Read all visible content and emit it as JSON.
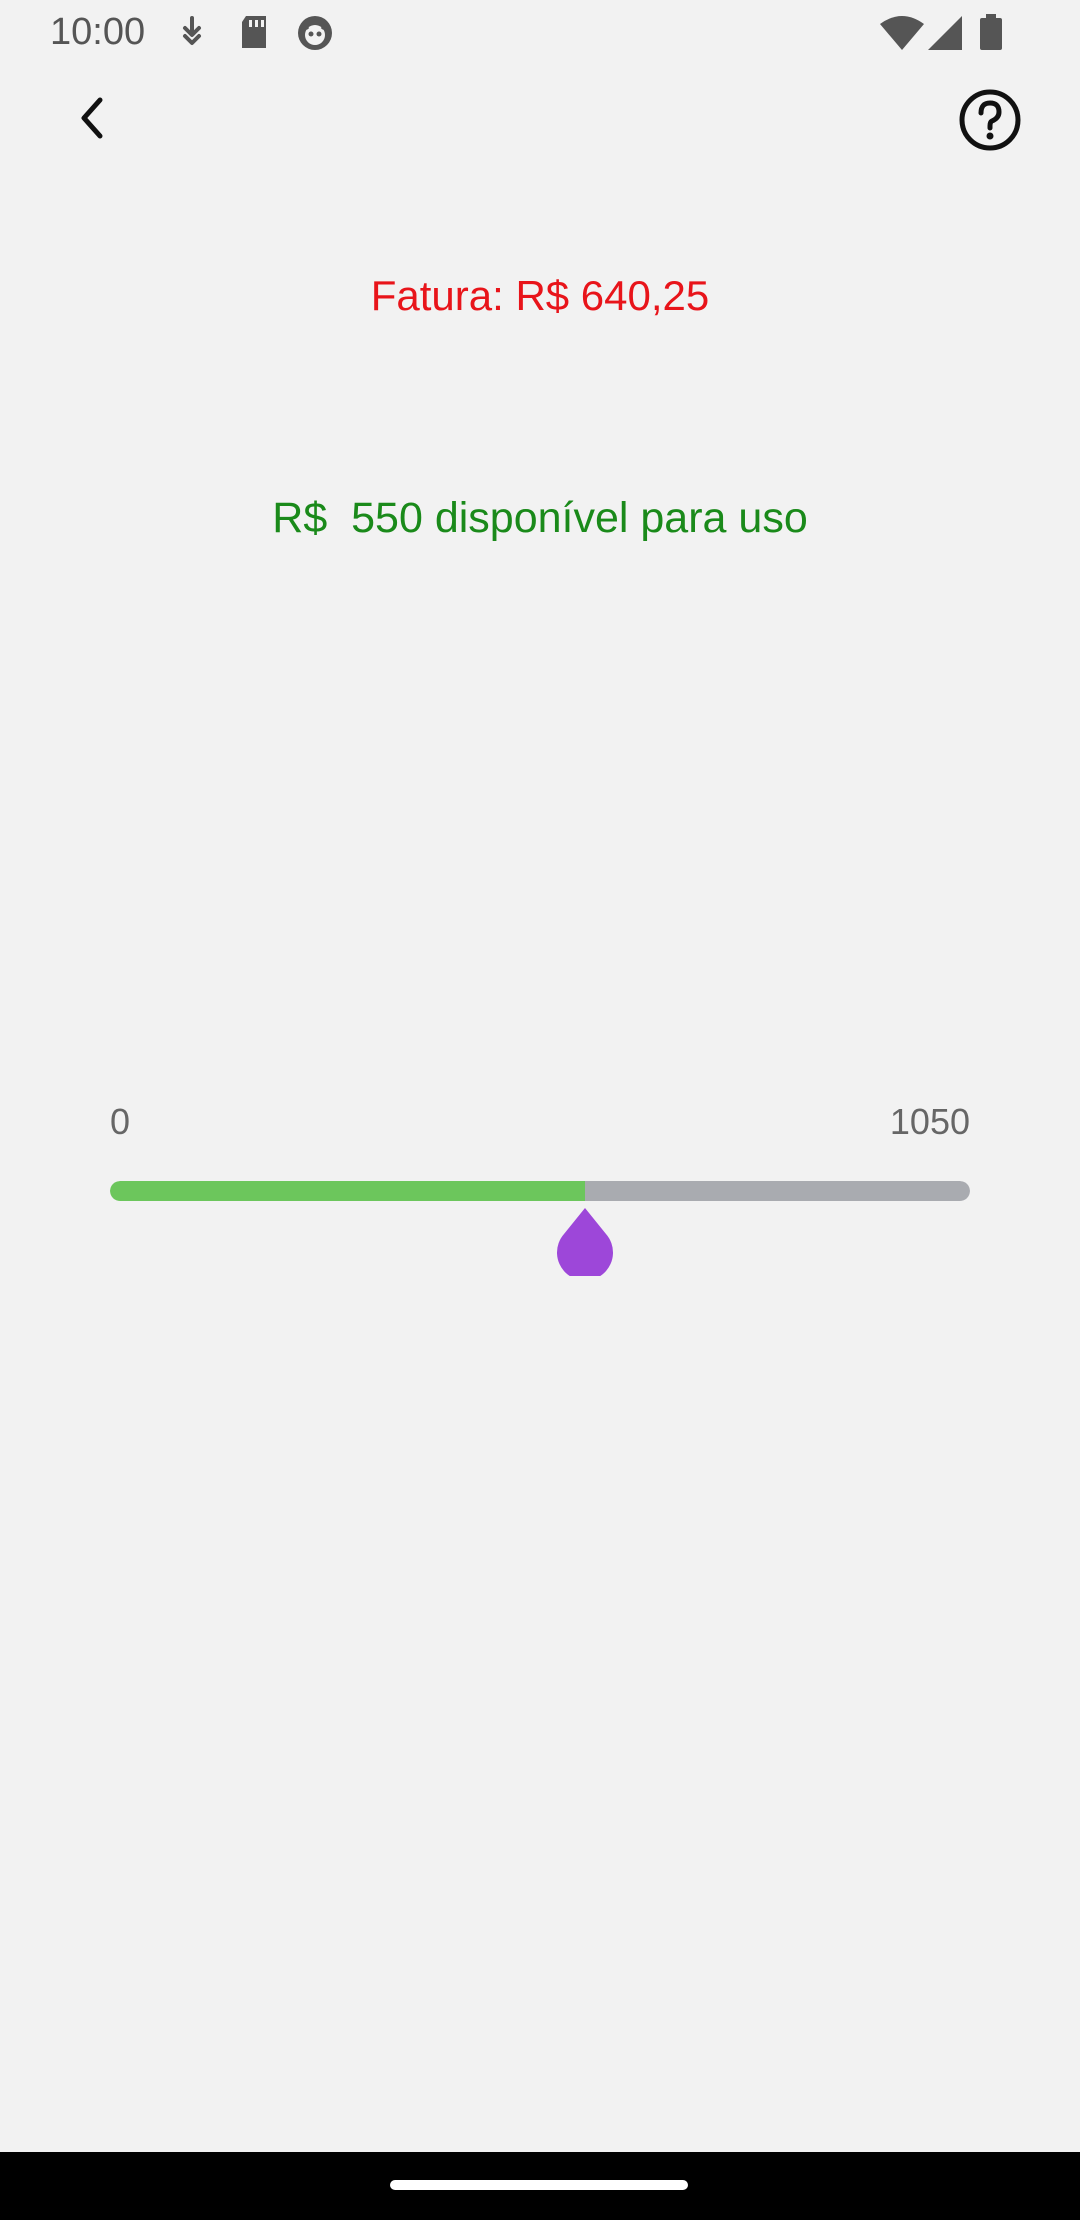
{
  "status_bar": {
    "time": "10:00",
    "icons": [
      "download-icon",
      "sd-card-icon",
      "notification-face-icon",
      "wifi-icon",
      "signal-icon",
      "battery-icon"
    ]
  },
  "app_bar": {
    "back_icon": "chevron-left-icon",
    "help_icon": "help-circle-icon"
  },
  "invoice": {
    "text": "Fatura: R$ 640,25",
    "color": "#e8141a"
  },
  "available": {
    "text": "R$  550 disponível para uso",
    "color": "#1a8a1a"
  },
  "slider": {
    "min_label": "0",
    "max_label": "1050",
    "min": 0,
    "max": 1050,
    "value": 580,
    "active_color": "#6cc65c",
    "inactive_color": "#a9abb0",
    "thumb_color": "#9d47d9"
  }
}
